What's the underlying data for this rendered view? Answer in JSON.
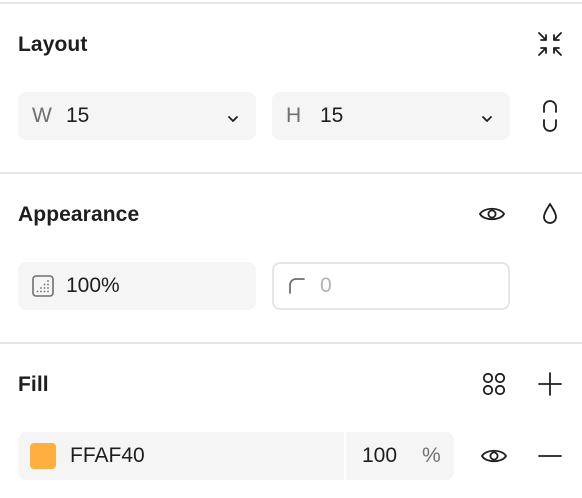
{
  "layout": {
    "title": "Layout",
    "collapse_icon": "collapse-arrows-icon",
    "width": {
      "prefix": "W",
      "value": "15"
    },
    "height": {
      "prefix": "H",
      "value": "15"
    },
    "constrain_icon": "link-proportions-icon"
  },
  "appearance": {
    "title": "Appearance",
    "visibility_icon": "eye-icon",
    "blend_icon": "drop-icon",
    "opacity": {
      "icon": "opacity-icon",
      "value": "100%"
    },
    "corner_radius": {
      "icon": "corner-radius-icon",
      "placeholder": "0"
    }
  },
  "fill": {
    "title": "Fill",
    "styles_icon": "styles-grid-icon",
    "add_icon": "plus-icon",
    "items": [
      {
        "color": "#FFAF40",
        "hex": "FFAF40",
        "opacity": "100",
        "unit": "%",
        "visibility_icon": "eye-icon",
        "remove_icon": "minus-icon"
      }
    ]
  }
}
